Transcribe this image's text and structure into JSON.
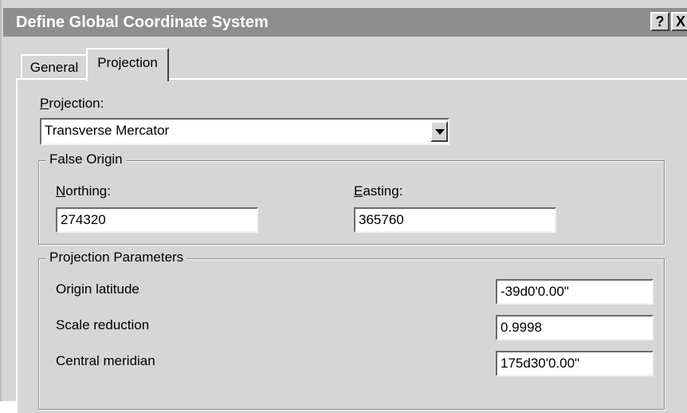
{
  "window": {
    "title": "Define Global Coordinate System",
    "help_label": "?",
    "close_label": "X"
  },
  "tabs": [
    {
      "label": "General",
      "active": false
    },
    {
      "label": "Projection",
      "active": true
    }
  ],
  "projection": {
    "label_accel": "P",
    "label_rest": "rojection:",
    "selected": "Transverse Mercator"
  },
  "false_origin": {
    "title": "False Origin",
    "northing": {
      "label_accel": "N",
      "label_rest": "orthing:",
      "value": "274320"
    },
    "easting": {
      "label_accel": "E",
      "label_rest": "asting:",
      "value": "365760"
    }
  },
  "parameters": {
    "title": "Projection Parameters",
    "origin_latitude": {
      "label": "Origin latitude",
      "value": "-39d0'0.00\""
    },
    "scale_reduction": {
      "label": "Scale reduction",
      "value": "0.9998"
    },
    "central_meridian": {
      "label": "Central meridian",
      "value": "175d30'0.00\""
    }
  }
}
